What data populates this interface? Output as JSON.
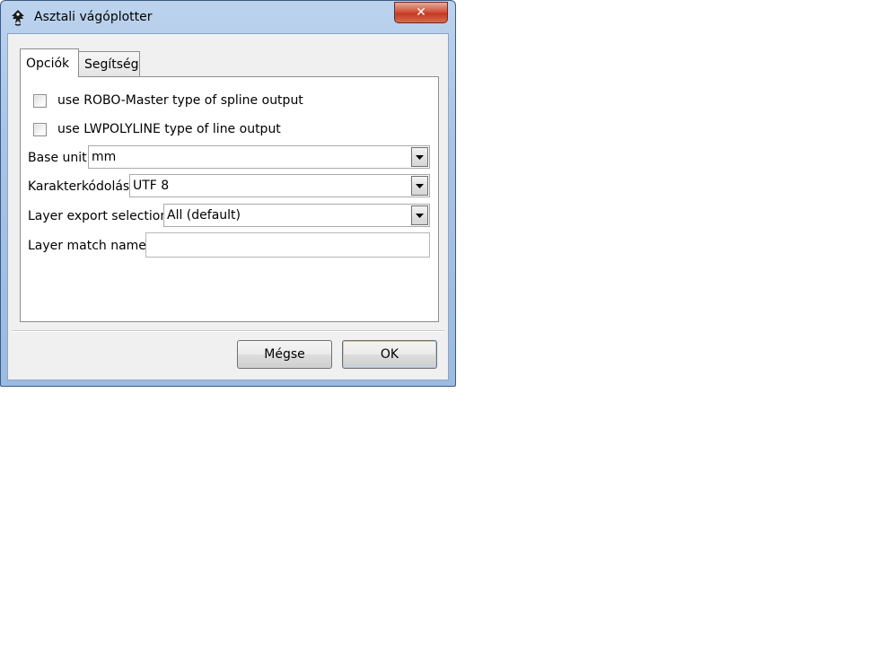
{
  "window": {
    "title": "Asztali vágóplotter",
    "close_symbol": "✕"
  },
  "tabs": [
    {
      "label": "Opciók",
      "active": true
    },
    {
      "label": "Segítség",
      "active": false
    }
  ],
  "options": {
    "robo_master_checkbox": {
      "label": "use ROBO-Master type of spline output",
      "checked": false
    },
    "lwpolyline_checkbox": {
      "label": "use LWPOLYLINE type of line output",
      "checked": false
    },
    "base_unit": {
      "label": "Base unit",
      "value": "mm"
    },
    "encoding": {
      "label": "Karakterkódolás",
      "value": "UTF 8"
    },
    "layer_export": {
      "label": "Layer export selection",
      "value": "All (default)"
    },
    "layer_match": {
      "label": "Layer match name",
      "value": ""
    }
  },
  "buttons": {
    "cancel_label": "Mégse",
    "ok_label": "OK"
  },
  "icons": {
    "app": "inkscape-icon",
    "close": "close-icon",
    "dropdown": "chevron-down-icon"
  }
}
